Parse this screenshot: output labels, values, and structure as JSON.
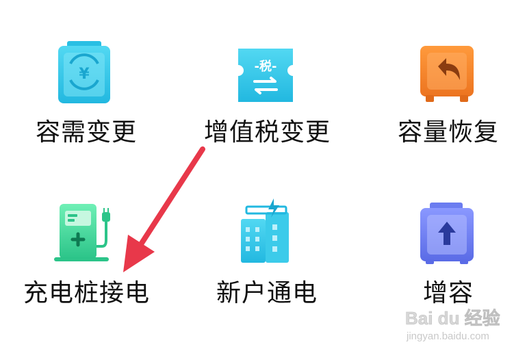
{
  "services": [
    {
      "label": "容需变更",
      "icon": "yuan-swap-icon",
      "icon_text": "¥"
    },
    {
      "label": "增值税变更",
      "icon": "tax-ticket-icon",
      "icon_text": "-税-"
    },
    {
      "label": "容量恢复",
      "icon": "undo-arrow-icon",
      "icon_text": ""
    },
    {
      "label": "充电桩接电",
      "icon": "charging-pile-icon",
      "icon_text": ""
    },
    {
      "label": "新户通电",
      "icon": "building-power-icon",
      "icon_text": ""
    },
    {
      "label": "增容",
      "icon": "capacity-up-icon",
      "icon_text": ""
    }
  ],
  "watermark": {
    "brand": "Bai du 经验",
    "url": "jingyan.baidu.com"
  },
  "colors": {
    "cyan": "#2ec6e8",
    "orange": "#f2842a",
    "green": "#3ad19a",
    "indigo": "#6b7cf0",
    "arrow": "#e8384a",
    "label": "#111111"
  }
}
